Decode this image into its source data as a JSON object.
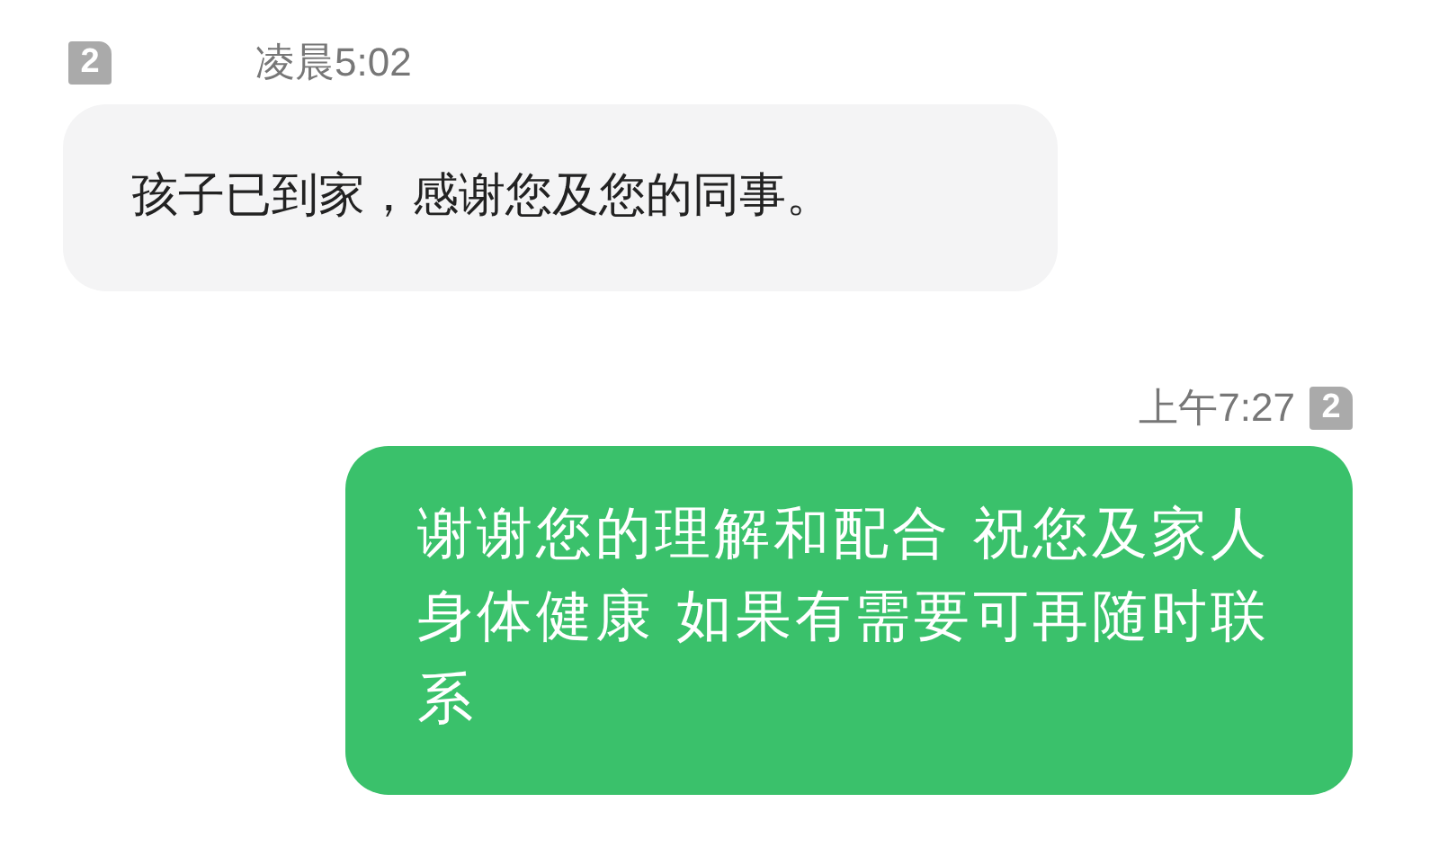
{
  "messages": [
    {
      "kind": "received",
      "sim": "2",
      "time": "凌晨5:02",
      "text": "孩子已到家，感谢您及您的同事。"
    },
    {
      "kind": "sent",
      "sim": "2",
      "time": "上午7:27",
      "text": "谢谢您的理解和配合 祝您及家人身体健康 如果有需要可再随时联系"
    }
  ]
}
